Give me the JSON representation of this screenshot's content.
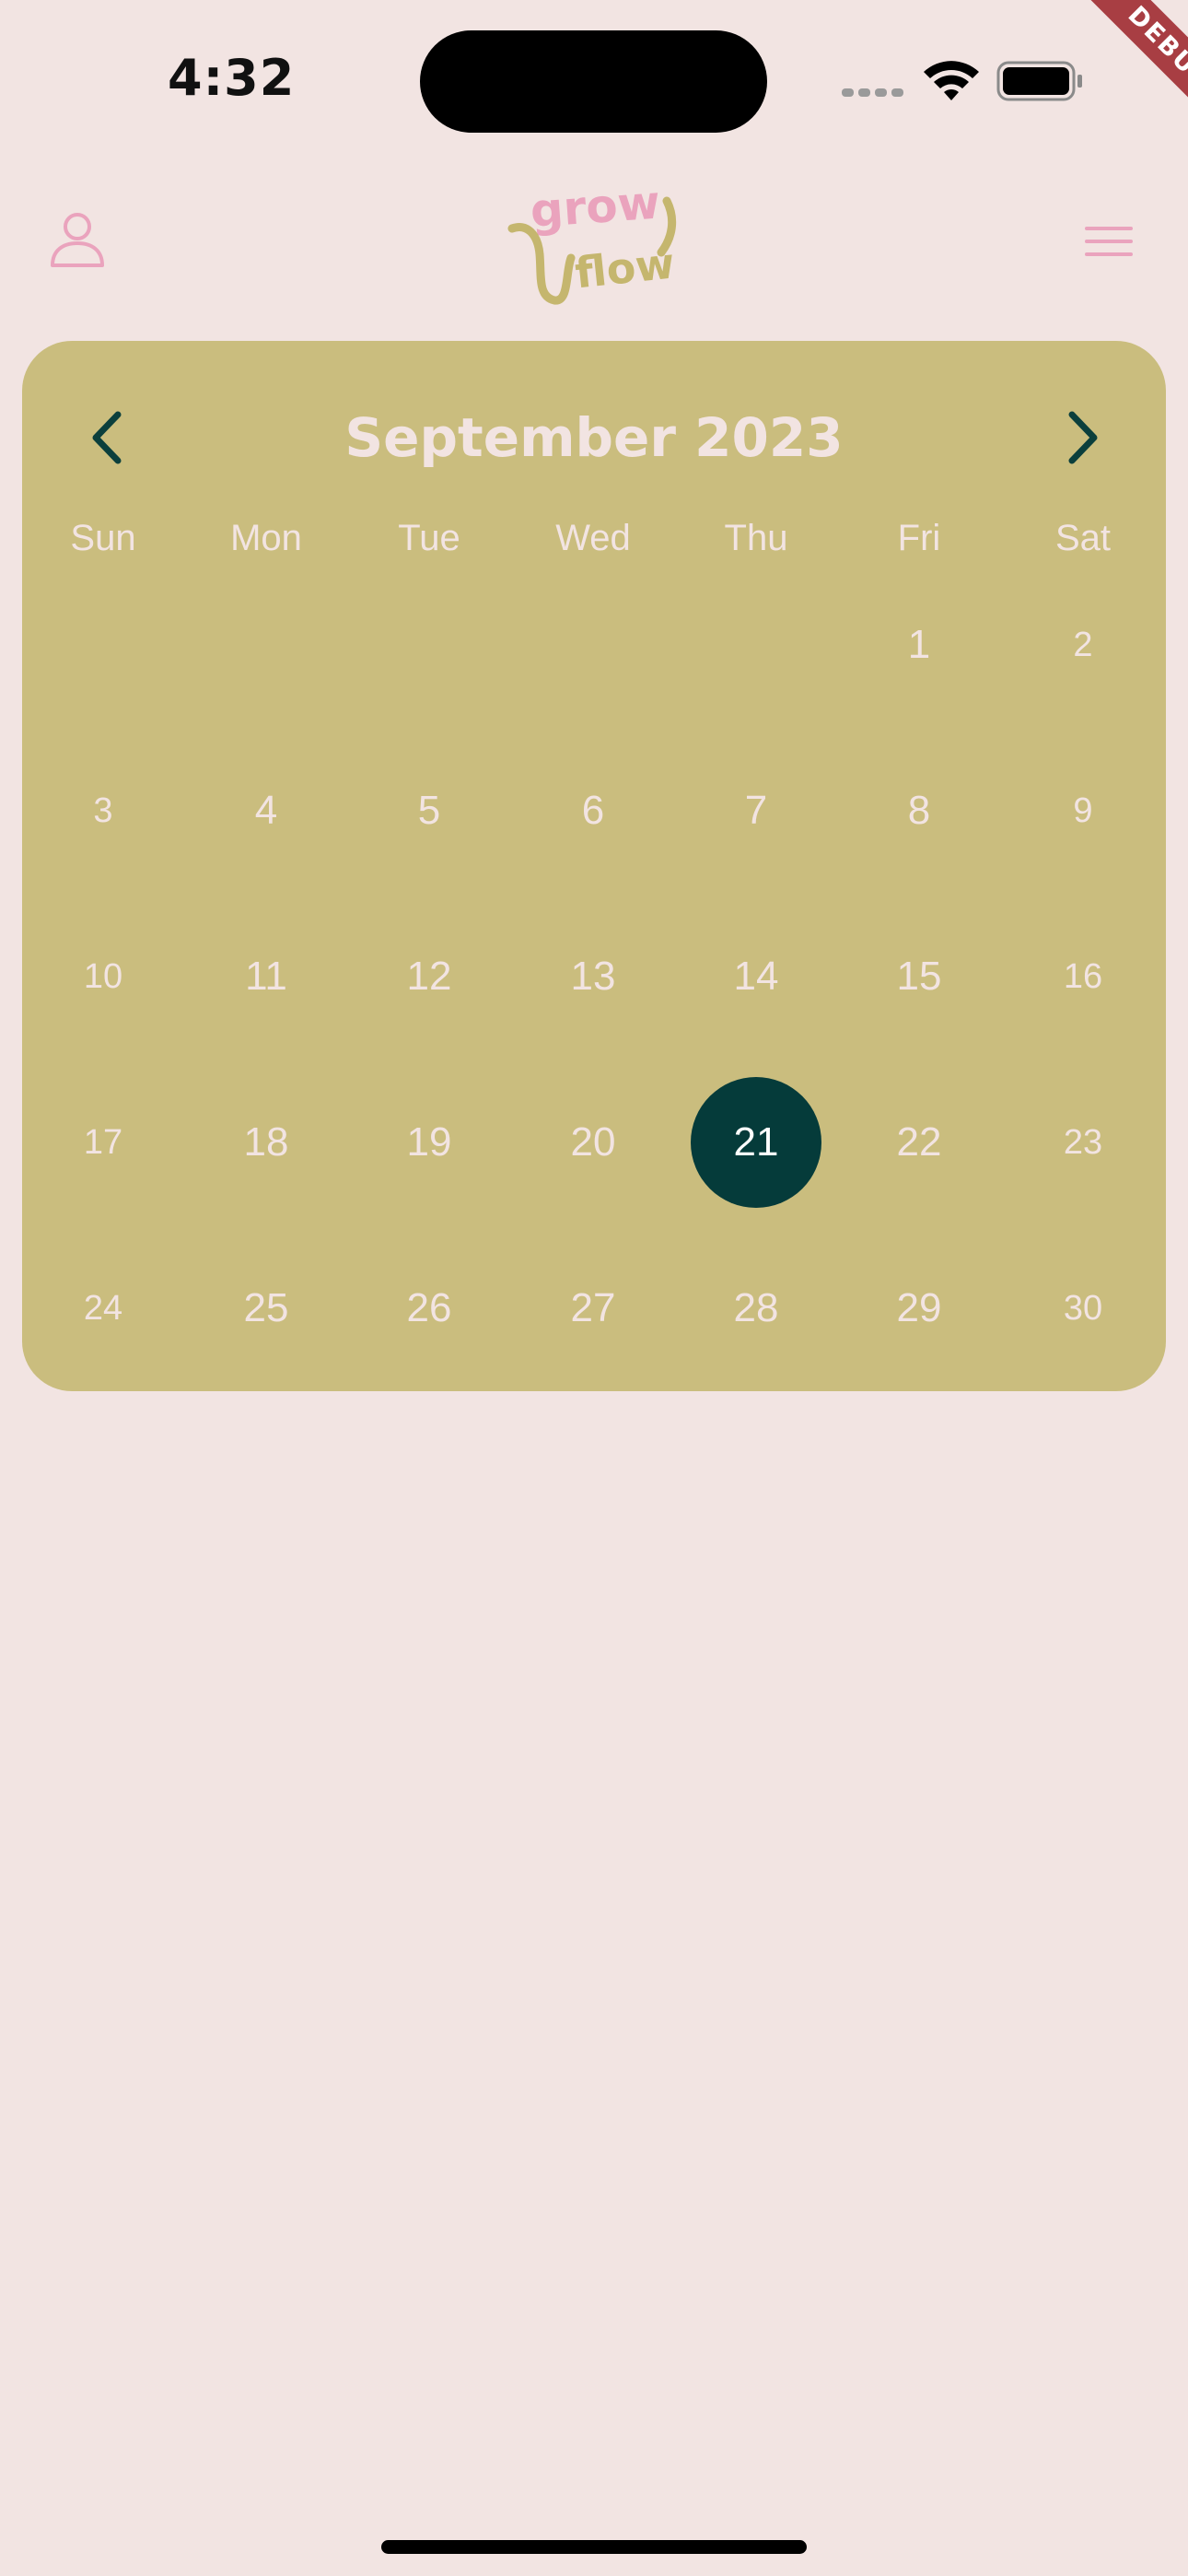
{
  "status_bar": {
    "time": "4:32",
    "signal_icon": "cellular-signal-icon",
    "wifi_icon": "wifi-icon",
    "battery_icon": "battery-icon"
  },
  "debug_banner": "DEBUG",
  "app_bar": {
    "profile_icon": "person-icon",
    "logo_text_top": "grow",
    "logo_text_bottom": "flow",
    "menu_icon": "hamburger-menu-icon"
  },
  "calendar": {
    "month_title": "September 2023",
    "prev_icon": "chevron-left-icon",
    "next_icon": "chevron-right-icon",
    "weekdays": [
      "Sun",
      "Mon",
      "Tue",
      "Wed",
      "Thu",
      "Fri",
      "Sat"
    ],
    "weeks": [
      [
        "",
        "",
        "",
        "",
        "",
        "1",
        "2"
      ],
      [
        "3",
        "4",
        "5",
        "6",
        "7",
        "8",
        "9"
      ],
      [
        "10",
        "11",
        "12",
        "13",
        "14",
        "15",
        "16"
      ],
      [
        "17",
        "18",
        "19",
        "20",
        "21",
        "22",
        "23"
      ],
      [
        "24",
        "25",
        "26",
        "27",
        "28",
        "29",
        "30"
      ]
    ],
    "selected_day": "21"
  },
  "colors": {
    "background": "#f2e4e2",
    "calendar_background": "#cabd7e",
    "selected_day": "#053b3a",
    "accent_pink": "#eaa3bd",
    "logo_olive": "#c5b66e",
    "chevron": "#0b3f3c",
    "debug_banner": "#a83e43"
  }
}
